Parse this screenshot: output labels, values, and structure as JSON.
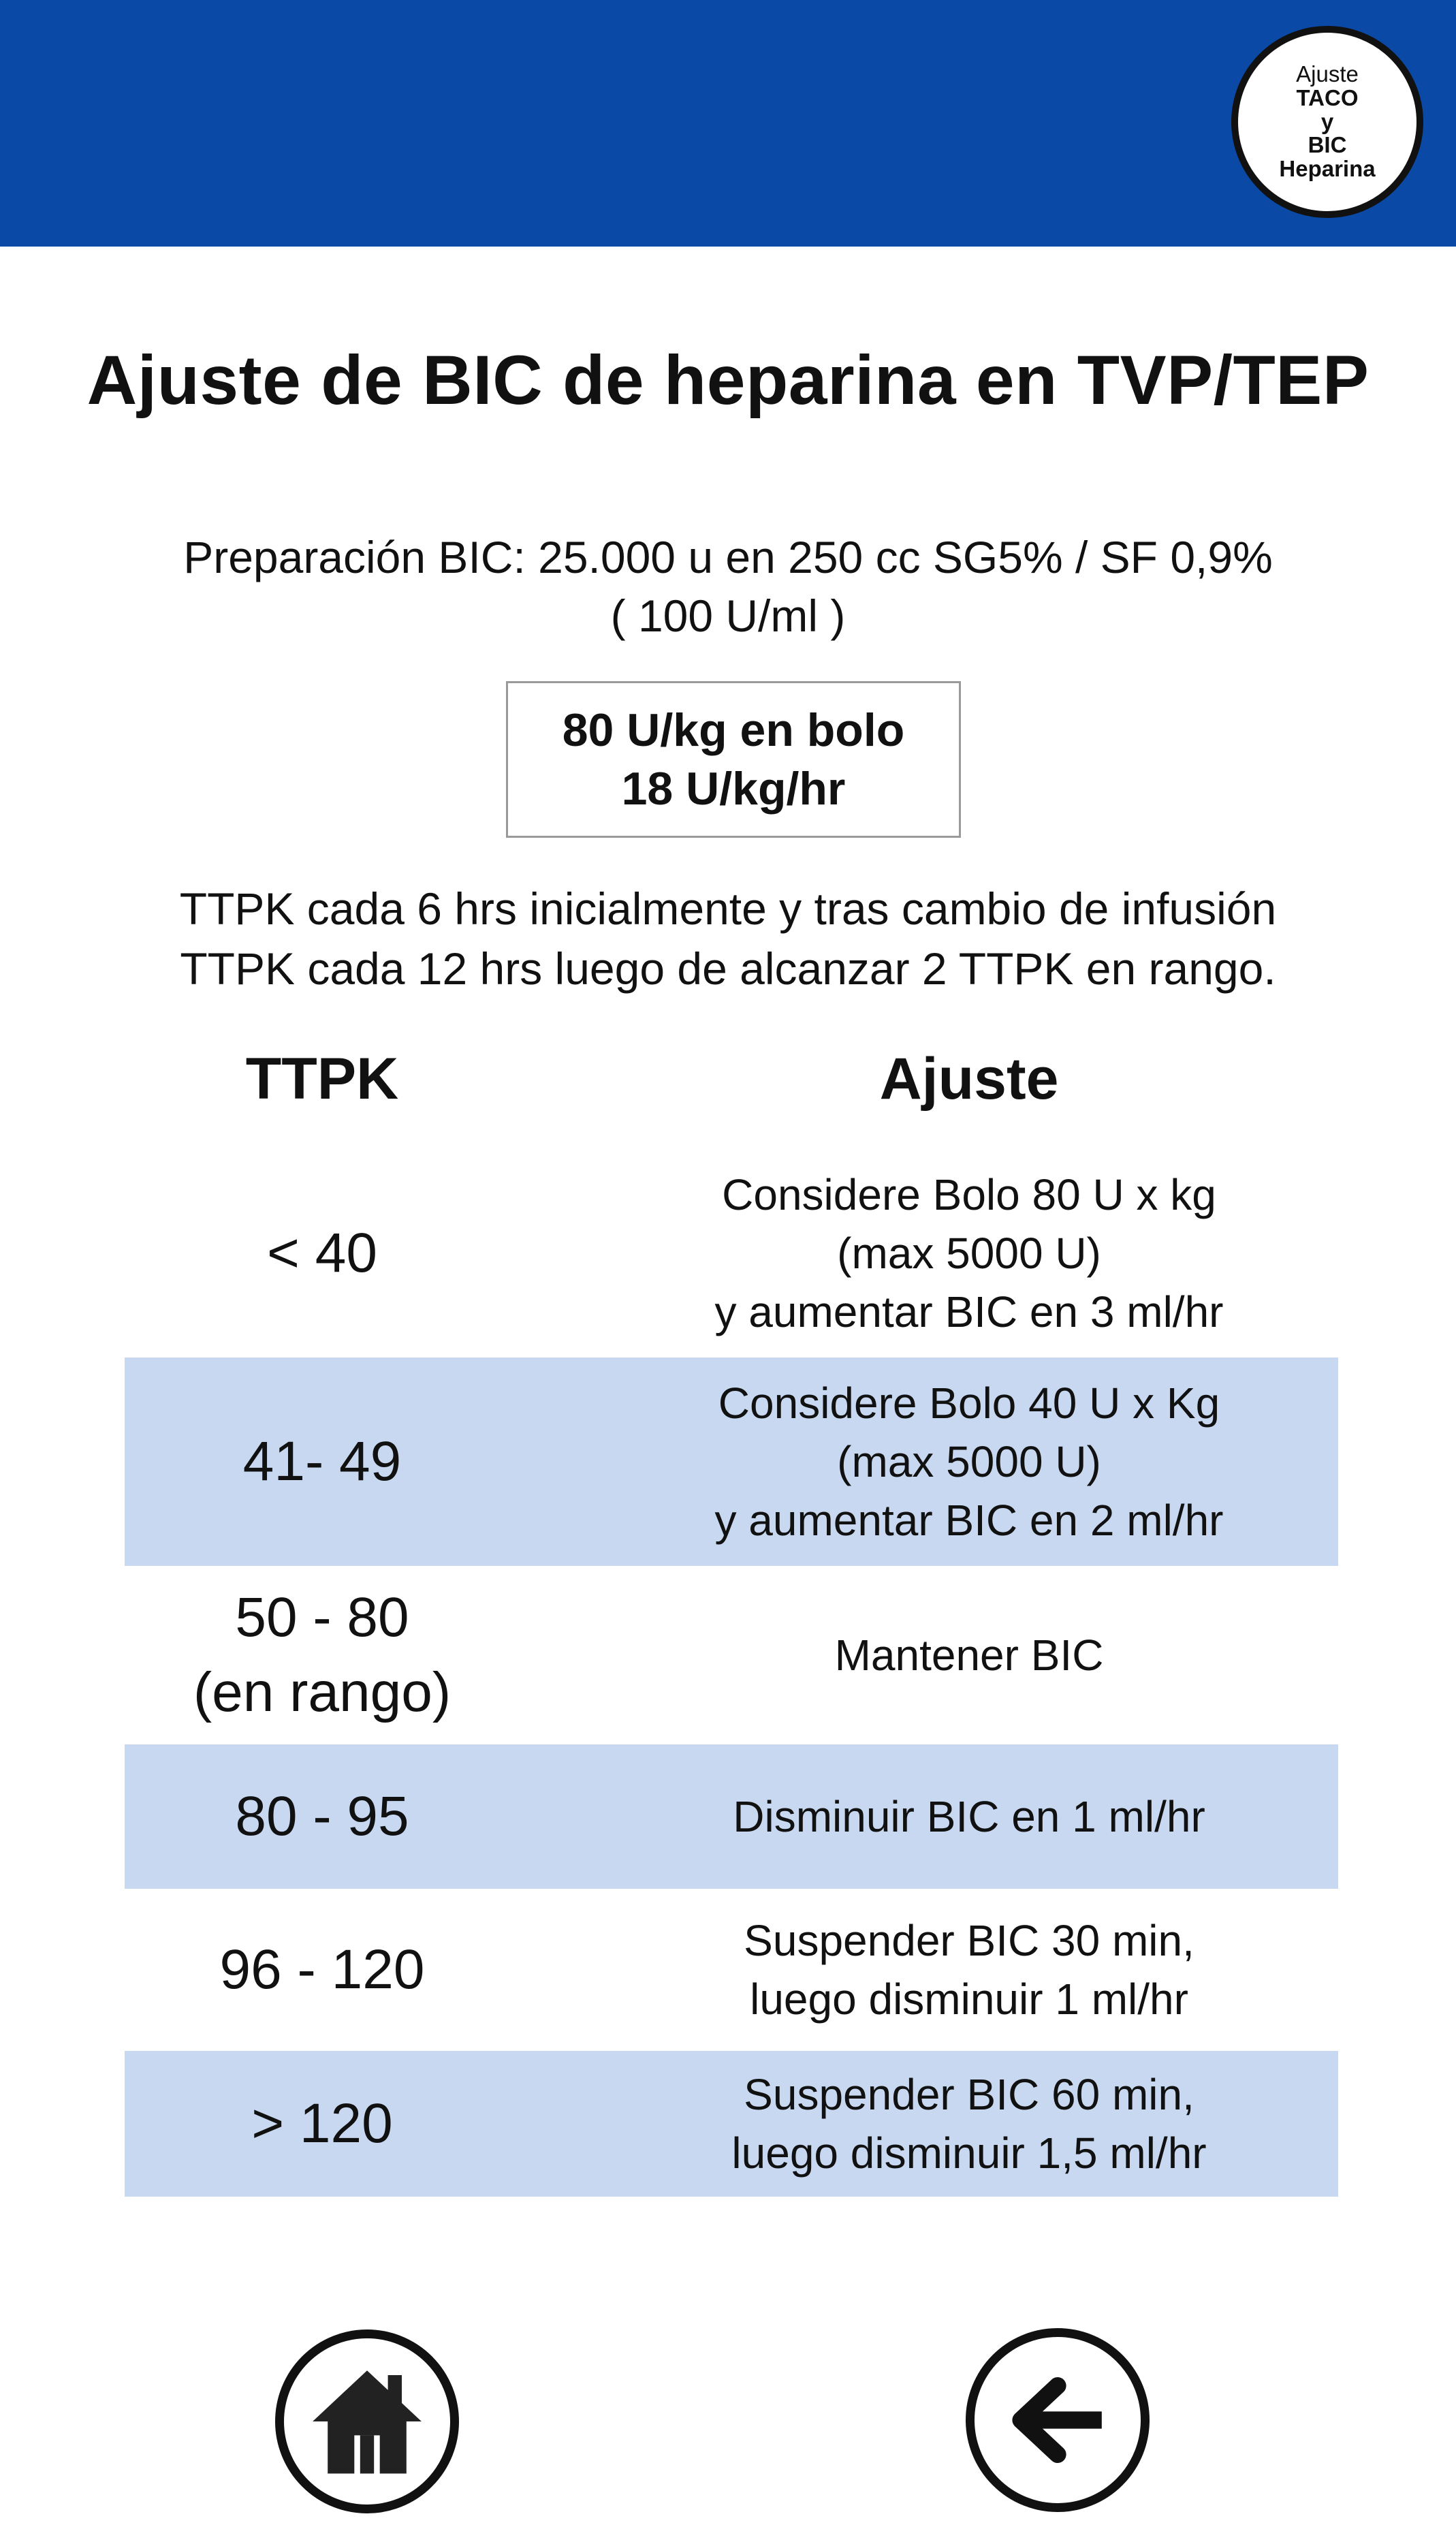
{
  "header": {
    "badge_lines": [
      "Ajuste",
      "TACO",
      "y",
      "BIC",
      "Heparina"
    ]
  },
  "title": "Ajuste de BIC de heparina en TVP/TEP",
  "preparation": {
    "line1": "Preparación BIC: 25.000 u en 250 cc SG5% / SF 0,9%",
    "line2": "( 100 U/ml )"
  },
  "dose_box": {
    "bolus": "80 U/kg en bolo",
    "infusion": "18 U/kg/hr"
  },
  "ttpk_notes": {
    "line1": "TTPK cada 6 hrs inicialmente y tras cambio de infusión",
    "line2": "TTPK cada 12 hrs luego de alcanzar 2 TTPK en rango."
  },
  "table": {
    "headers": {
      "ttpk": "TTPK",
      "adjustment": "Ajuste"
    },
    "rows": [
      {
        "ttpk": [
          "< 40"
        ],
        "adjustment": [
          "Considere Bolo 80 U x kg",
          "(max 5000 U)",
          "y aumentar BIC en 3 ml/hr"
        ],
        "shaded": false
      },
      {
        "ttpk": [
          "41- 49"
        ],
        "adjustment": [
          "Considere Bolo 40 U x Kg",
          "(max 5000 U)",
          "y aumentar BIC en 2 ml/hr"
        ],
        "shaded": true
      },
      {
        "ttpk": [
          "50 - 80",
          "(en rango)"
        ],
        "adjustment": [
          "Mantener BIC"
        ],
        "shaded": false
      },
      {
        "ttpk": [
          "80 - 95"
        ],
        "adjustment": [
          "Disminuir BIC en 1 ml/hr"
        ],
        "shaded": true
      },
      {
        "ttpk": [
          "96 - 120"
        ],
        "adjustment": [
          "Suspender BIC 30 min,",
          "luego disminuir 1 ml/hr"
        ],
        "shaded": false
      },
      {
        "ttpk": [
          "> 120"
        ],
        "adjustment": [
          "Suspender BIC 60 min,",
          "luego disminuir 1,5 ml/hr"
        ],
        "shaded": true
      }
    ]
  },
  "nav": {
    "home_icon": "home-icon",
    "back_icon": "arrow-left-icon"
  },
  "colors": {
    "header": "#0a4aa6",
    "row_shade": "#c7d8f0"
  }
}
